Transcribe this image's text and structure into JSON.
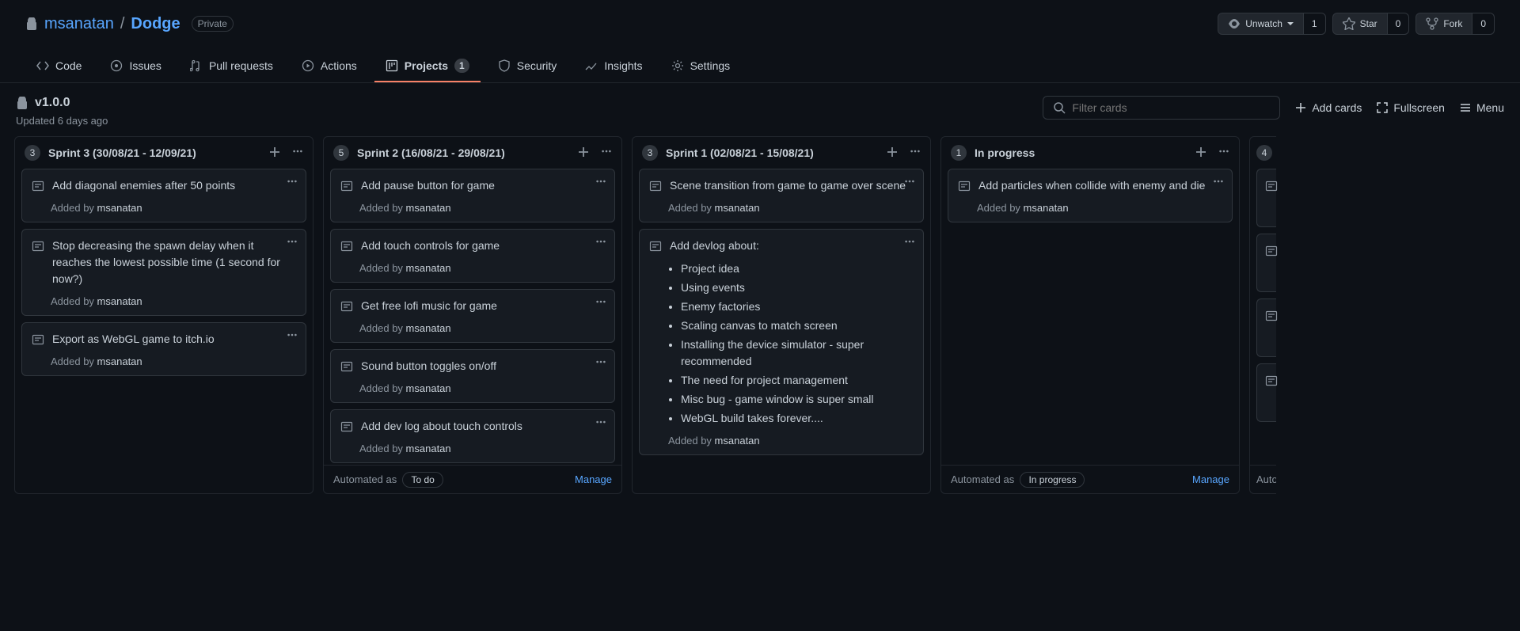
{
  "repo": {
    "owner": "msanatan",
    "name": "Dodge",
    "visibility": "Private"
  },
  "actions": {
    "watch": {
      "label": "Unwatch",
      "count": "1"
    },
    "star": {
      "label": "Star",
      "count": "0"
    },
    "fork": {
      "label": "Fork",
      "count": "0"
    }
  },
  "tabs": {
    "code": "Code",
    "issues": "Issues",
    "pulls": "Pull requests",
    "actions": "Actions",
    "projects": "Projects",
    "projects_count": "1",
    "security": "Security",
    "insights": "Insights",
    "settings": "Settings"
  },
  "project": {
    "name": "v1.0.0",
    "updated": "Updated 6 days ago",
    "filter_placeholder": "Filter cards",
    "add_cards": "Add cards",
    "fullscreen": "Fullscreen",
    "menu": "Menu"
  },
  "added_by_prefix": "Added by ",
  "automated_as": "Automated as",
  "manage": "Manage",
  "partial_auto": "Auto",
  "columns": [
    {
      "count": "3",
      "title": "Sprint 3 (30/08/21 - 12/09/21)",
      "has_footer": false,
      "cards": [
        {
          "text": "Add diagonal enemies after 50 points",
          "added_by": "msanatan"
        },
        {
          "text": "Stop decreasing the spawn delay when it reaches the lowest possible time (1 second for now?)",
          "added_by": "msanatan"
        },
        {
          "text": "Export as WebGL game to itch.io",
          "added_by": "msanatan"
        }
      ]
    },
    {
      "count": "5",
      "title": "Sprint 2 (16/08/21 - 29/08/21)",
      "has_footer": true,
      "footer_status": "To do",
      "cards": [
        {
          "text": "Add pause button for game",
          "added_by": "msanatan"
        },
        {
          "text": "Add touch controls for game",
          "added_by": "msanatan"
        },
        {
          "text": "Get free lofi music for game",
          "added_by": "msanatan"
        },
        {
          "text": "Sound button toggles on/off",
          "added_by": "msanatan"
        },
        {
          "text": "Add dev log about touch controls",
          "added_by": "msanatan"
        }
      ]
    },
    {
      "count": "3",
      "title": "Sprint 1 (02/08/21 - 15/08/21)",
      "has_footer": false,
      "cards": [
        {
          "text": "Scene transition from game to game over scene",
          "added_by": "msanatan"
        },
        {
          "text": "Add devlog about:",
          "added_by": "msanatan",
          "list": [
            "Project idea",
            "Using events",
            "Enemy factories",
            "Scaling canvas to match screen",
            "Installing the device simulator - super recommended",
            "The need for project management",
            "Misc bug - game window is super small",
            "WebGL build takes forever...."
          ]
        }
      ]
    },
    {
      "count": "1",
      "title": "In progress",
      "has_footer": true,
      "footer_status": "In progress",
      "cards": [
        {
          "text": "Add particles when collide with enemy and die",
          "added_by": "msanatan"
        }
      ]
    }
  ],
  "partial_column": {
    "count": "4",
    "card_count": 4
  }
}
